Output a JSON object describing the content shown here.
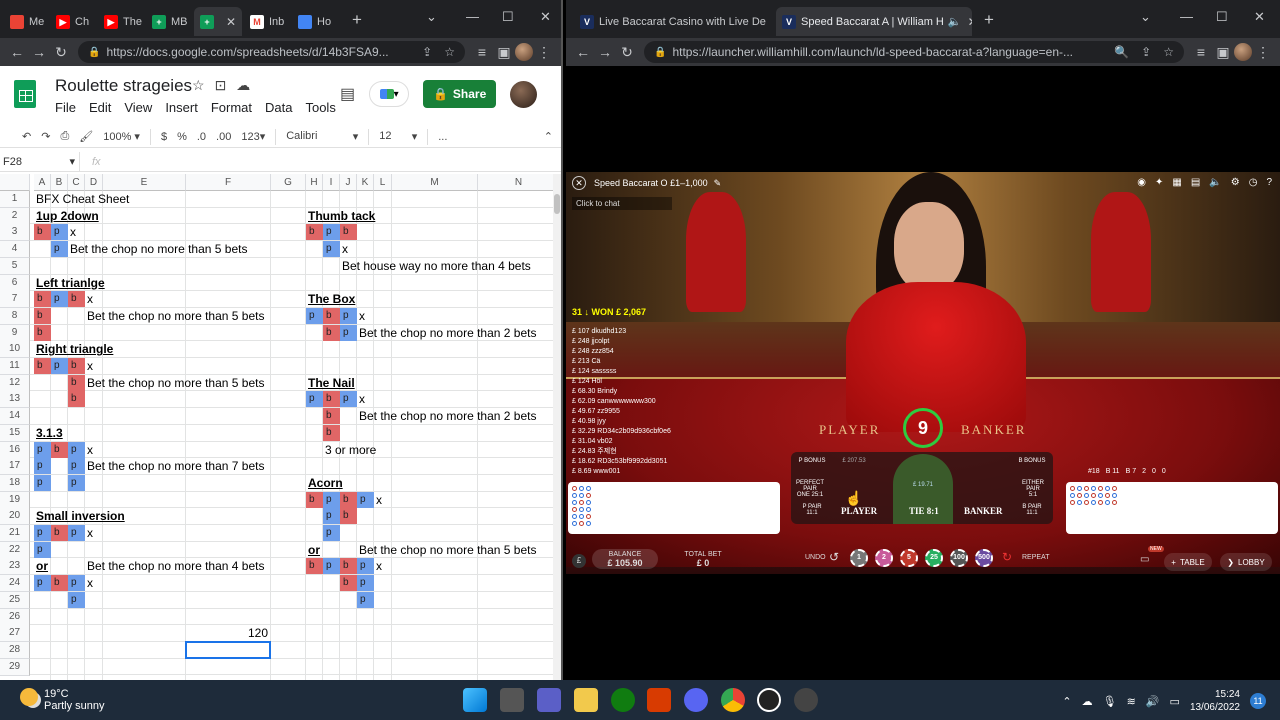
{
  "left_browser": {
    "tabs": [
      {
        "label": "Me",
        "color": "#ea4335"
      },
      {
        "label": "Ch",
        "color": "#ff0000"
      },
      {
        "label": "The",
        "color": "#ff0000"
      },
      {
        "label": "MB",
        "color": "#0f9d58"
      },
      {
        "label": "",
        "color": "#0f9d58"
      },
      {
        "label": "Inb",
        "color": "#ea4335"
      },
      {
        "label": "Ho",
        "color": "#4285f4"
      }
    ],
    "url": "https://docs.google.com/spreadsheets/d/14b3FSA9..."
  },
  "sheets": {
    "title": "Roulette strageies",
    "menu": [
      "File",
      "Edit",
      "View",
      "Insert",
      "Format",
      "Data",
      "Tools"
    ],
    "share_label": "Share",
    "toolbar": {
      "zoom": "100%",
      "currency": "$",
      "percent": "%",
      "dec_less": ".0",
      "dec_more": ".00",
      "format": "123",
      "font": "Calibri",
      "font_size": "12",
      "more": "..."
    },
    "name_box": "F28",
    "fx": "fx",
    "columns": [
      "A",
      "B",
      "C",
      "D",
      "E",
      "F",
      "G",
      "H",
      "I",
      "J",
      "K",
      "L",
      "M",
      "N"
    ],
    "rows": [
      "1",
      "2",
      "3",
      "4",
      "5",
      "6",
      "7",
      "8",
      "9",
      "10",
      "11",
      "12",
      "13",
      "14",
      "15",
      "16",
      "17",
      "18",
      "19",
      "20",
      "21",
      "22",
      "23",
      "24",
      "25",
      "26",
      "27",
      "28",
      "29"
    ],
    "cells": {
      "r1": "BFX Cheat Sheet",
      "h_1up2down": "1up 2down",
      "h_thumbtack": "Thumb tack",
      "t_bet_chop_5": "Bet the chop no more than 5 bets",
      "t_house_4": "Bet house way no more than 4 bets",
      "h_left_triangle": "Left trianlge",
      "h_the_box": "The Box",
      "t_chop_5b": "Bet the chop no more than 5 bets",
      "t_chop_2": "Bet the chop no more than 2 bets",
      "h_right_triangle": "Right triangle",
      "t_chop_5c": "Bet the chop no more than 5 bets",
      "h_the_nail": "The Nail",
      "t_chop_2b": "Bet the chop no more than 2 bets",
      "h_313": "3.1.3",
      "t_3ormore": "3 or more",
      "t_chop_7": "Bet the chop no more than 7 bets",
      "h_acorn": "Acorn",
      "h_small_inversion": "Small inversion",
      "t_or1": "or",
      "t_chop_5d": "Bet the chop no more than 5 bets",
      "t_or2": "or",
      "t_chop_4": "Bet the chop no more than 4 bets",
      "f27": "120",
      "x": "x",
      "b": "b",
      "p": "p"
    }
  },
  "right_browser": {
    "tabs": [
      {
        "label": "Live Baccarat Casino with Live De"
      },
      {
        "label": "Speed Baccarat A | William H"
      }
    ],
    "url": "https://launcher.williamhill.com/launch/ld-speed-baccarat-a?language=en-..."
  },
  "casino": {
    "table_name": "Speed Baccarat O",
    "limits": "£1–1,000",
    "chat": "Click to chat",
    "winners_header": "31 ↓ WON £ 2,067",
    "winners": [
      "£ 107 dkudhd123",
      "£ 248 jjcolpt",
      "£ 248 zzz854",
      "£ 213 Cä",
      "£ 124 sasssss",
      "£ 124 Höl",
      "£ 68.30 Brindy",
      "£ 62.09 canwwwwwww300",
      "£ 49.67 zz9955",
      "£ 40.98 jyy",
      "£ 32.29 RD34c2b09d936cbf0e6",
      "£ 31.04 vb02",
      "£ 24.83 주제현",
      "£ 18.62 RD3c53bf9992dd3051",
      "£ 8.69 www001"
    ],
    "timer": "9",
    "felt_player": "PLAYER",
    "felt_banker": "BANKER",
    "bets": {
      "p_bonus": "P BONUS",
      "b_bonus": "B BONUS",
      "perfect_pair": "PERFECT PAIR",
      "perfect_pair_odds": "ONE 25:1",
      "either_pair": "EITHER PAIR",
      "either_pair_odds": "5:1",
      "p_pair": "P PAIR",
      "p_pair_odds": "11:1",
      "b_pair": "B PAIR",
      "b_pair_odds": "11:1",
      "player": "PLAYER",
      "tie": "TIE 8:1",
      "banker": "BANKER",
      "player_amount": "£ 207.53",
      "tie_amount": "£ 19.71"
    },
    "stats": [
      "#18",
      "B 11",
      "B 7",
      "2",
      "0",
      "0"
    ],
    "balance_label": "BALANCE",
    "balance": "£ 105.90",
    "total_bet_label": "TOTAL BET",
    "total_bet": "£ 0",
    "undo": "UNDO",
    "chips": [
      {
        "v": "1",
        "c": "#777"
      },
      {
        "v": "2",
        "c": "#c85a9a"
      },
      {
        "v": "5",
        "c": "#c0392b"
      },
      {
        "v": "25",
        "c": "#27ae60"
      },
      {
        "v": "100",
        "c": "#555"
      },
      {
        "v": "500",
        "c": "#6b4ba0"
      }
    ],
    "repeat": "REPEAT",
    "table_btn": "TABLE",
    "lobby_btn": "LOBBY",
    "new_badge": "NEW"
  },
  "taskbar": {
    "temp": "19°C",
    "weather": "Partly sunny",
    "time": "15:24",
    "date": "13/06/2022",
    "notif": "11"
  }
}
